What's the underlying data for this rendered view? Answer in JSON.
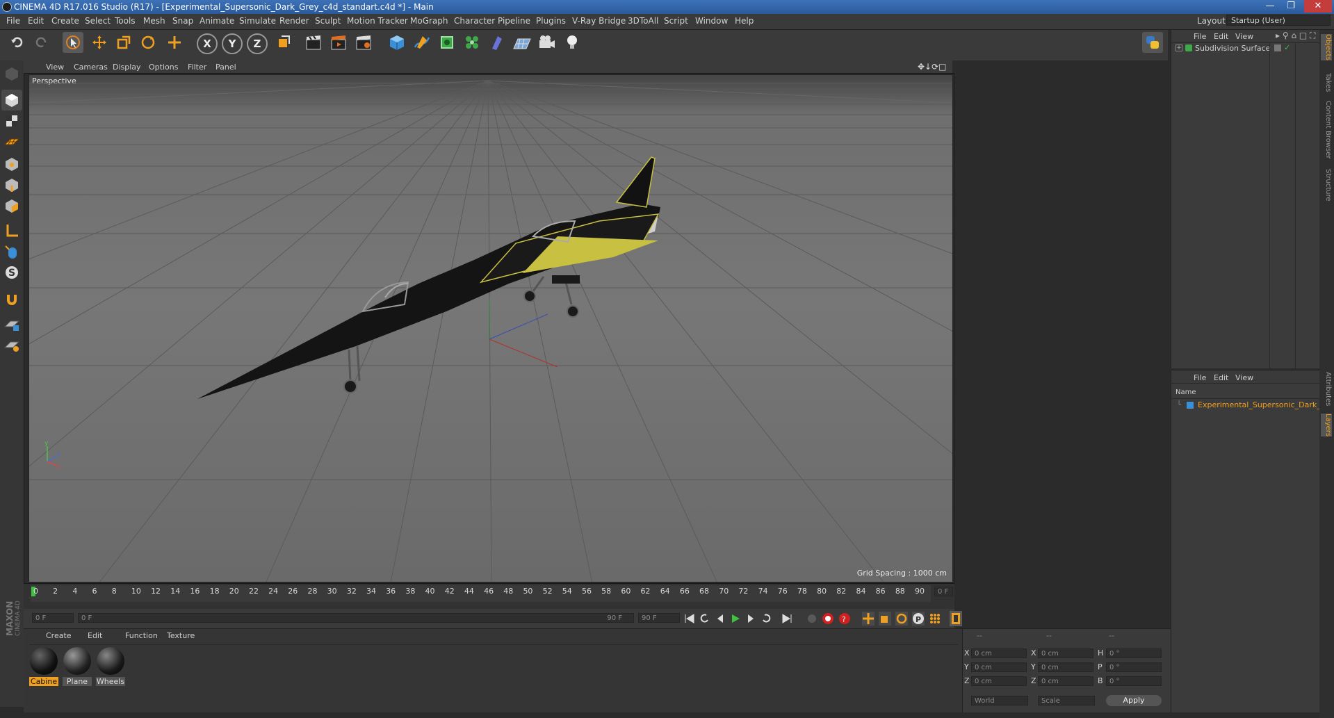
{
  "window": {
    "title": "CINEMA 4D R17.016 Studio (R17) - [Experimental_Supersonic_Dark_Grey_c4d_standart.c4d *] - Main"
  },
  "menubar": {
    "items": [
      "File",
      "Edit",
      "Create",
      "Select",
      "Tools",
      "Mesh",
      "Snap",
      "Animate",
      "Simulate",
      "Render",
      "Sculpt",
      "Motion Tracker",
      "MoGraph",
      "Character",
      "Pipeline",
      "Plugins",
      "V-Ray Bridge",
      "3DToAll",
      "Script",
      "Window",
      "Help"
    ],
    "layout_label": "Layout:",
    "layout_value": "Startup (User)"
  },
  "toolbar": {
    "axis_x": "X",
    "axis_y": "Y",
    "axis_z": "Z"
  },
  "viewport": {
    "menu": [
      "View",
      "Cameras",
      "Display",
      "Options",
      "Filter",
      "Panel"
    ],
    "camera_label": "Perspective",
    "grid_spacing": "Grid Spacing : 1000 cm"
  },
  "timeline": {
    "ticks": [
      "0",
      "2",
      "4",
      "6",
      "8",
      "10",
      "12",
      "14",
      "16",
      "18",
      "20",
      "22",
      "24",
      "26",
      "28",
      "30",
      "32",
      "34",
      "36",
      "38",
      "40",
      "42",
      "44",
      "46",
      "48",
      "50",
      "52",
      "54",
      "56",
      "58",
      "60",
      "62",
      "64",
      "66",
      "68",
      "70",
      "72",
      "74",
      "76",
      "78",
      "80",
      "82",
      "84",
      "86",
      "88",
      "90"
    ],
    "current_frame": "0 F",
    "start_field": "0 F",
    "range_start": "0 F",
    "range_end": "90 F",
    "end_field": "90 F"
  },
  "materials": {
    "menu": [
      "Create",
      "Edit",
      "Function",
      "Texture"
    ],
    "items": [
      {
        "label": "Cabine",
        "selected": true
      },
      {
        "label": "Plane",
        "selected": false
      },
      {
        "label": "Wheels",
        "selected": false
      }
    ]
  },
  "coordinates": {
    "header": [
      "--",
      "--",
      "--"
    ],
    "rows": [
      {
        "a": "X",
        "av": "0 cm",
        "b": "X",
        "bv": "0 cm",
        "c": "H",
        "cv": "0 °"
      },
      {
        "a": "Y",
        "av": "0 cm",
        "b": "Y",
        "bv": "0 cm",
        "c": "P",
        "cv": "0 °"
      },
      {
        "a": "Z",
        "av": "0 cm",
        "b": "Z",
        "bv": "0 cm",
        "c": "B",
        "cv": "0 °"
      }
    ],
    "mode1": "World",
    "mode2": "Scale",
    "apply": "Apply"
  },
  "objects_panel": {
    "menu": [
      "File",
      "Edit",
      "View"
    ],
    "items": [
      {
        "name": "Subdivision Surface"
      }
    ]
  },
  "layers_panel": {
    "menu": [
      "File",
      "Edit",
      "View"
    ],
    "column_name": "Name",
    "items": [
      {
        "name": "Experimental_Supersonic_Dark_Gr"
      }
    ]
  },
  "right_tabs": [
    "Objects",
    "Takes",
    "Content Browser",
    "Structure",
    "Attributes",
    "Layers"
  ],
  "branding": {
    "maxon": "MAXON",
    "product": "CINEMA 4D"
  },
  "colors": {
    "accent": "#f0a020",
    "selected_text": "#f0a020",
    "title_bar": "#2f62a8",
    "play_green": "#3fc23f",
    "record_red": "#d02020"
  }
}
